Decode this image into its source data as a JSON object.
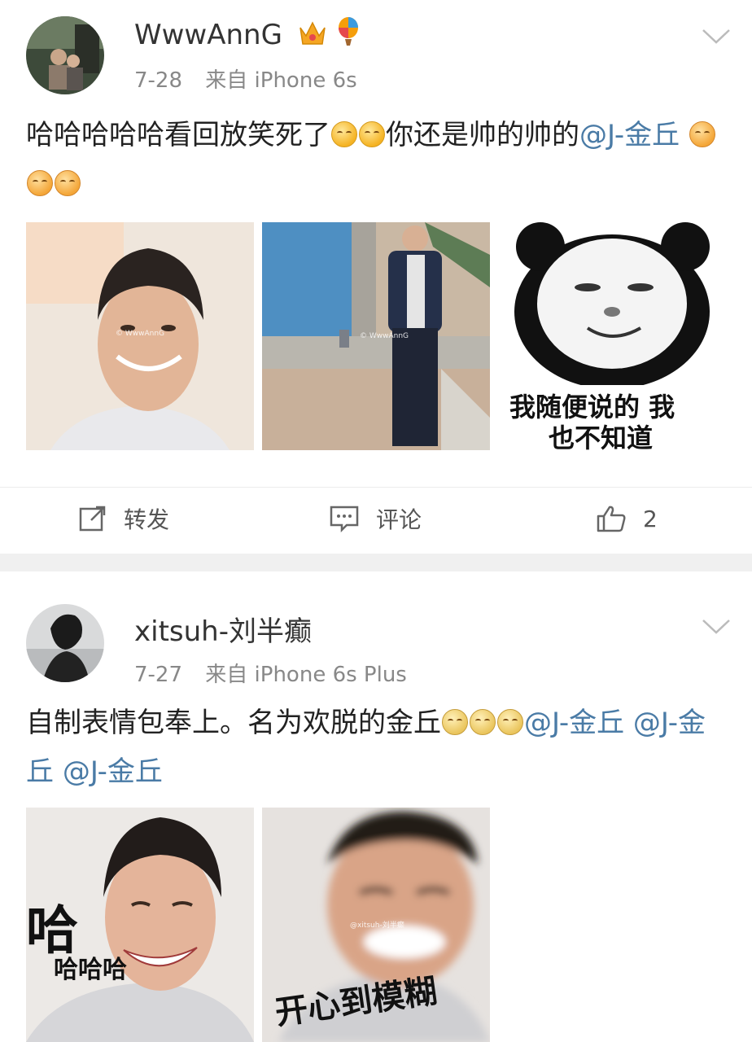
{
  "posts": [
    {
      "username": "WwwAnnG",
      "badges": [
        "crown-icon",
        "balloon-icon"
      ],
      "date": "7-28",
      "source": "来自 iPhone 6s",
      "text_plain": "哈哈哈哈哈看回放笑死了",
      "text_mid": "你还是帅的帅的",
      "mention": "@J-金丘",
      "images": [
        {
          "watermark": "© WwwAnnG",
          "caption": ""
        },
        {
          "watermark": "© WwwAnnG",
          "caption": ""
        },
        {
          "watermark": "",
          "caption_line1": "我随便说的 我",
          "caption_line2": "也不知道"
        }
      ],
      "actions": {
        "repost": "转发",
        "comment": "评论",
        "like_count": "2"
      }
    },
    {
      "username": "xitsuh-刘半癫",
      "date": "7-27",
      "source": "来自 iPhone 6s Plus",
      "text_plain": "自制表情包奉上。名为欢脱的金丘",
      "mentions": [
        "@J-金丘",
        "@J-金丘",
        "@J-金丘"
      ],
      "images": [
        {
          "caption_big": "哈",
          "caption_small": "哈哈哈"
        },
        {
          "watermark": "@xitsuh-刘半癫",
          "caption": "开心到模糊"
        }
      ]
    }
  ],
  "colors": {
    "mention": "#4a7ba6",
    "meta": "#888888",
    "divider": "#f0f0f0"
  }
}
